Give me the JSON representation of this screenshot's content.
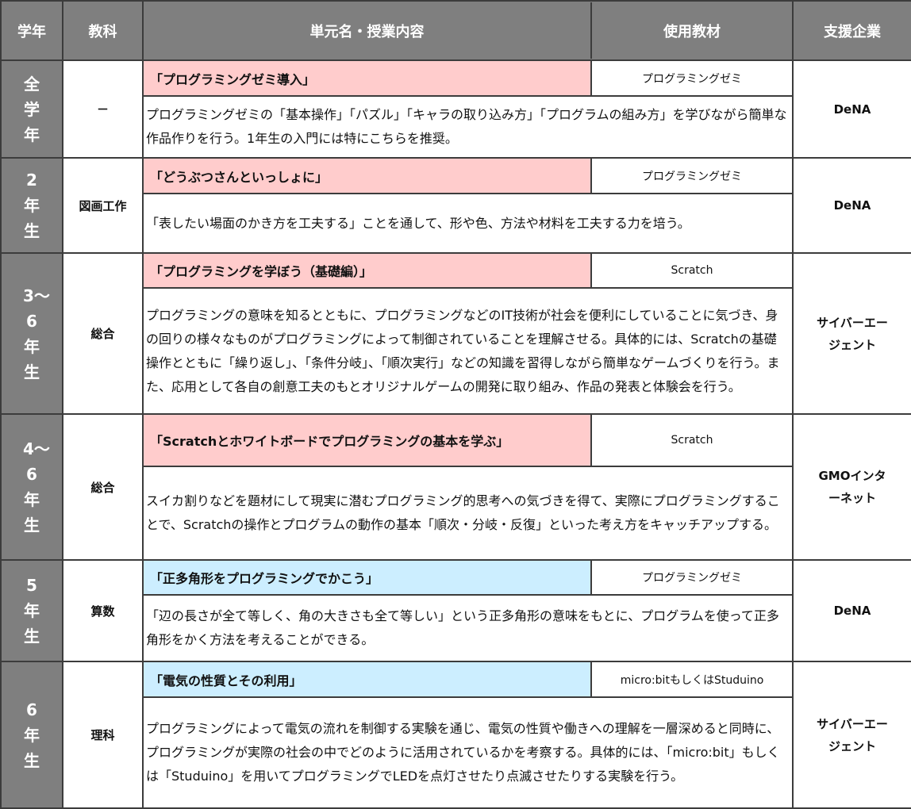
{
  "header": {
    "grade": "学年",
    "subject": "教科",
    "unit": "単元名・授業内容",
    "material": "使用教材",
    "company": "支援企業"
  },
  "rows": [
    {
      "grade": "全学年",
      "subject": "－",
      "title": "「プログラミングゼミ導入」",
      "title_color": "pink",
      "material": "プログラミングゼミ",
      "description": "プログラミングゼミの「基本操作」「パズル」「キャラの取り込み方」「プログラムの組み方」を学びながら簡単な作品作りを行う。1年生の入門には特にこちらを推奨。",
      "company": "DeNA"
    },
    {
      "grade": "2年生",
      "subject": "図画工作",
      "title": "「どうぶつさんといっしょに」",
      "title_color": "pink",
      "material": "プログラミングゼミ",
      "description": "「表したい場面のかき方を工夫する」ことを通して、形や色、方法や材料を工夫する力を培う。",
      "company": "DeNA"
    },
    {
      "grade": "3〜6年生",
      "subject": "総合",
      "title": "「プログラミングを学ぼう（基礎編）」",
      "title_color": "pink",
      "material": "Scratch",
      "description": "プログラミングの意味を知るとともに、プログラミングなどのIT技術が社会を便利にしていることに気づき、身の回りの様々なものがプログラミングによって制御されていることを理解させる。具体的には、Scratchの基礎操作とともに「繰り返し」、「条件分岐」、「順次実行」などの知識を習得しながら簡単なゲームづくりを行う。また、応用として各自の創意工夫のもとオリジナルゲームの開発に取り組み、作品の発表と体験会を行う。",
      "company": "サイバーエージェント"
    },
    {
      "grade": "4〜6年生",
      "subject": "総合",
      "title": "「Scratchとホワイトボードでプログラミングの基本を学ぶ」",
      "title_color": "pink",
      "material": "Scratch",
      "description": "スイカ割りなどを題材にして現実に潜むプログラミング的思考への気づきを得て、実際にプログラミングすることで、Scratchの操作とプログラムの動作の基本「順次・分岐・反復」といった考え方をキャッチアップする。",
      "company": "GMOインターネット"
    },
    {
      "grade": "5年生",
      "subject": "算数",
      "title": "「正多角形をプログラミングでかこう」",
      "title_color": "blue",
      "material": "プログラミングゼミ",
      "description": "「辺の長さが全て等しく、角の大きさも全て等しい」という正多角形の意味をもとに、プログラムを使って正多角形をかく方法を考えることができる。",
      "company": "DeNA"
    },
    {
      "grade": "6年生",
      "subject": "理科",
      "title": "「電気の性質とその利用」",
      "title_color": "blue",
      "material": "micro:bitもしくはStuduino",
      "description": "プログラミングによって電気の流れを制御する実験を通じ、電気の性質や働きへの理解を一層深めると同時に、プログラミングが実際の社会の中でどのように活用されているかを考察する。具体的には、「micro:bit」もしくは「Studuino」を用いてプログラミングでLEDを点灯させたり点滅させたりする実験を行う。",
      "company": "サイバーエージェント"
    }
  ],
  "colors": {
    "header_bg": "#7f7f7f",
    "pink_title": "#ffcccc",
    "blue_title": "#cceeff",
    "border": "#3c3c3c"
  }
}
